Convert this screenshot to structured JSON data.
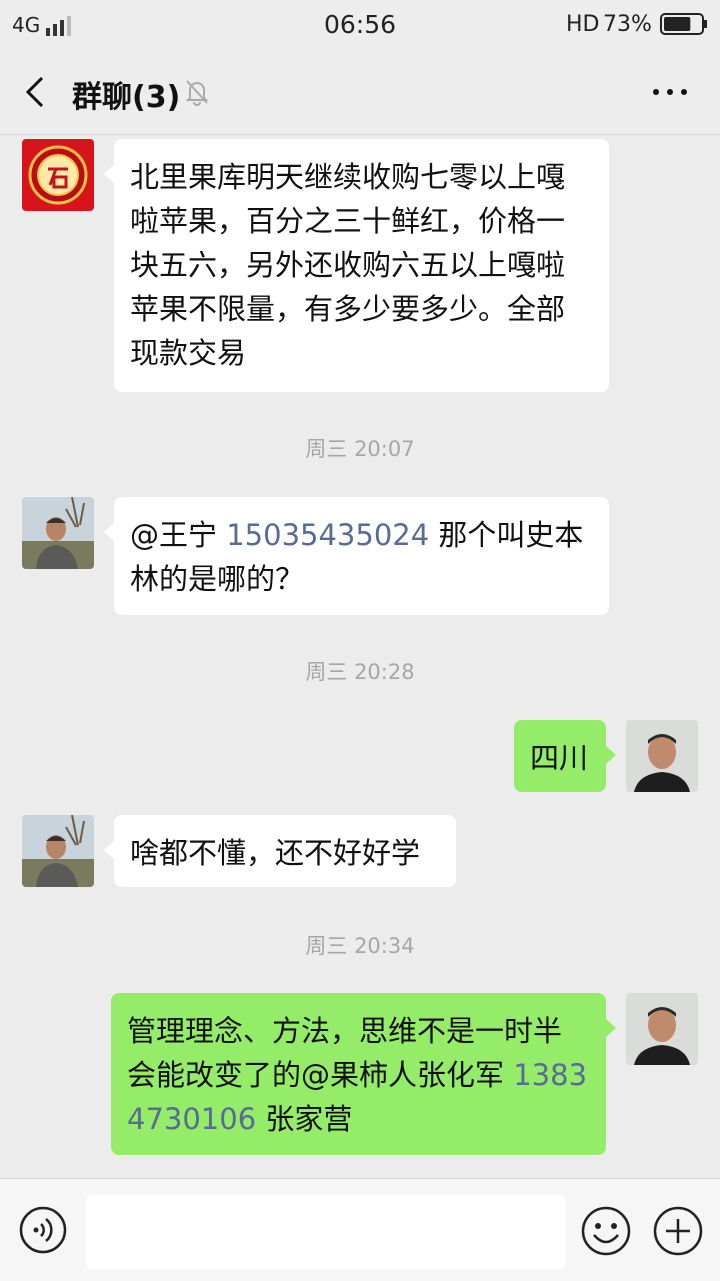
{
  "status_bar": {
    "network": "4G",
    "time": "06:56",
    "hd": "HD",
    "battery": "73%",
    "battery_level": 0.73
  },
  "header": {
    "title": "群聊(3)",
    "back_icon": "chevron-left-icon",
    "mute_icon": "bell-off-icon",
    "more_icon": "more-dots-icon"
  },
  "messages": [
    {
      "side": "left",
      "avatar": "seal-avatar",
      "text": "北里果库明天继续收购七零以上嘎啦苹果，百分之三十鲜红，价格一块五六，另外还收购六五以上嘎啦苹果不限量，有多少要多少。全部现款交易"
    },
    {
      "timestamp": "周三 20:07"
    },
    {
      "side": "left",
      "avatar": "orchard-man-avatar",
      "text_before": "@王宁 ",
      "phone": "15035435024",
      "text_after": " 那个叫史本林的是哪的？"
    },
    {
      "timestamp": "周三 20:28"
    },
    {
      "side": "right",
      "avatar": "self-avatar",
      "text": "四川"
    },
    {
      "side": "left",
      "avatar": "orchard-man-avatar",
      "text": "啥都不懂，还不好好学"
    },
    {
      "timestamp": "周三 20:34"
    },
    {
      "side": "right",
      "avatar": "self-avatar",
      "text_before": "管理理念、方法，思维不是一时半会能改变了的@果柿人张化军 ",
      "phone": "13834730106",
      "text_after": " 张家营"
    }
  ],
  "input_bar": {
    "voice_icon": "voice-icon",
    "emoji_icon": "emoji-icon",
    "plus_icon": "plus-icon",
    "input_value": ""
  },
  "colors": {
    "background": "#ececec",
    "bubble_left": "#ffffff",
    "bubble_right": "#95ec69",
    "link": "#576b95",
    "timestamp": "#a6a6a6"
  }
}
